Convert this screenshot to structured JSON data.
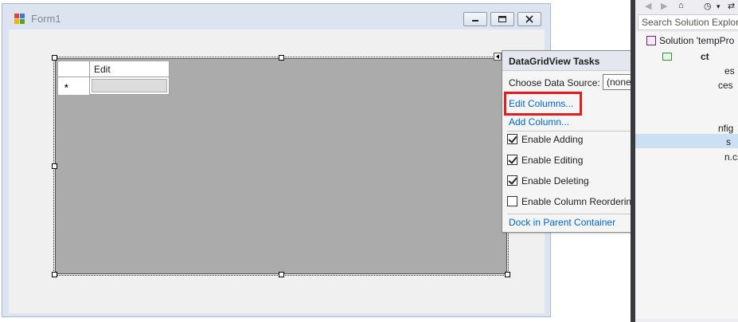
{
  "form": {
    "title": "Form1"
  },
  "grid": {
    "column_header": "Edit",
    "new_row_marker": "*"
  },
  "tasks": {
    "title": "DataGridView Tasks",
    "data_source_label": "Choose Data Source:",
    "data_source_value": "(none)",
    "edit_columns": "Edit Columns...",
    "add_column": "Add Column...",
    "options": [
      {
        "label": "Enable Adding",
        "checked": true
      },
      {
        "label": "Enable Editing",
        "checked": true
      },
      {
        "label": "Enable Deleting",
        "checked": true
      },
      {
        "label": "Enable Column Reordering",
        "checked": false
      }
    ],
    "dock": "Dock in Parent Container"
  },
  "solution_explorer": {
    "search_placeholder": "Search Solution Explore",
    "solution": "Solution 'tempPro",
    "project": "ct",
    "items": [
      "es",
      "ces",
      "nfig",
      "s",
      "n.cs"
    ]
  },
  "colors": {
    "highlight_box": "#e01e1e",
    "link": "#0066cc",
    "grid_background": "#ababab"
  },
  "icons": [
    "form-icon",
    "minimize-icon",
    "maximize-icon",
    "close-icon",
    "smart-tag-icon",
    "dropdown-arrow-icon",
    "back-icon",
    "forward-icon",
    "home-icon",
    "history-icon",
    "sync-icon",
    "solution-icon",
    "project-icon"
  ]
}
